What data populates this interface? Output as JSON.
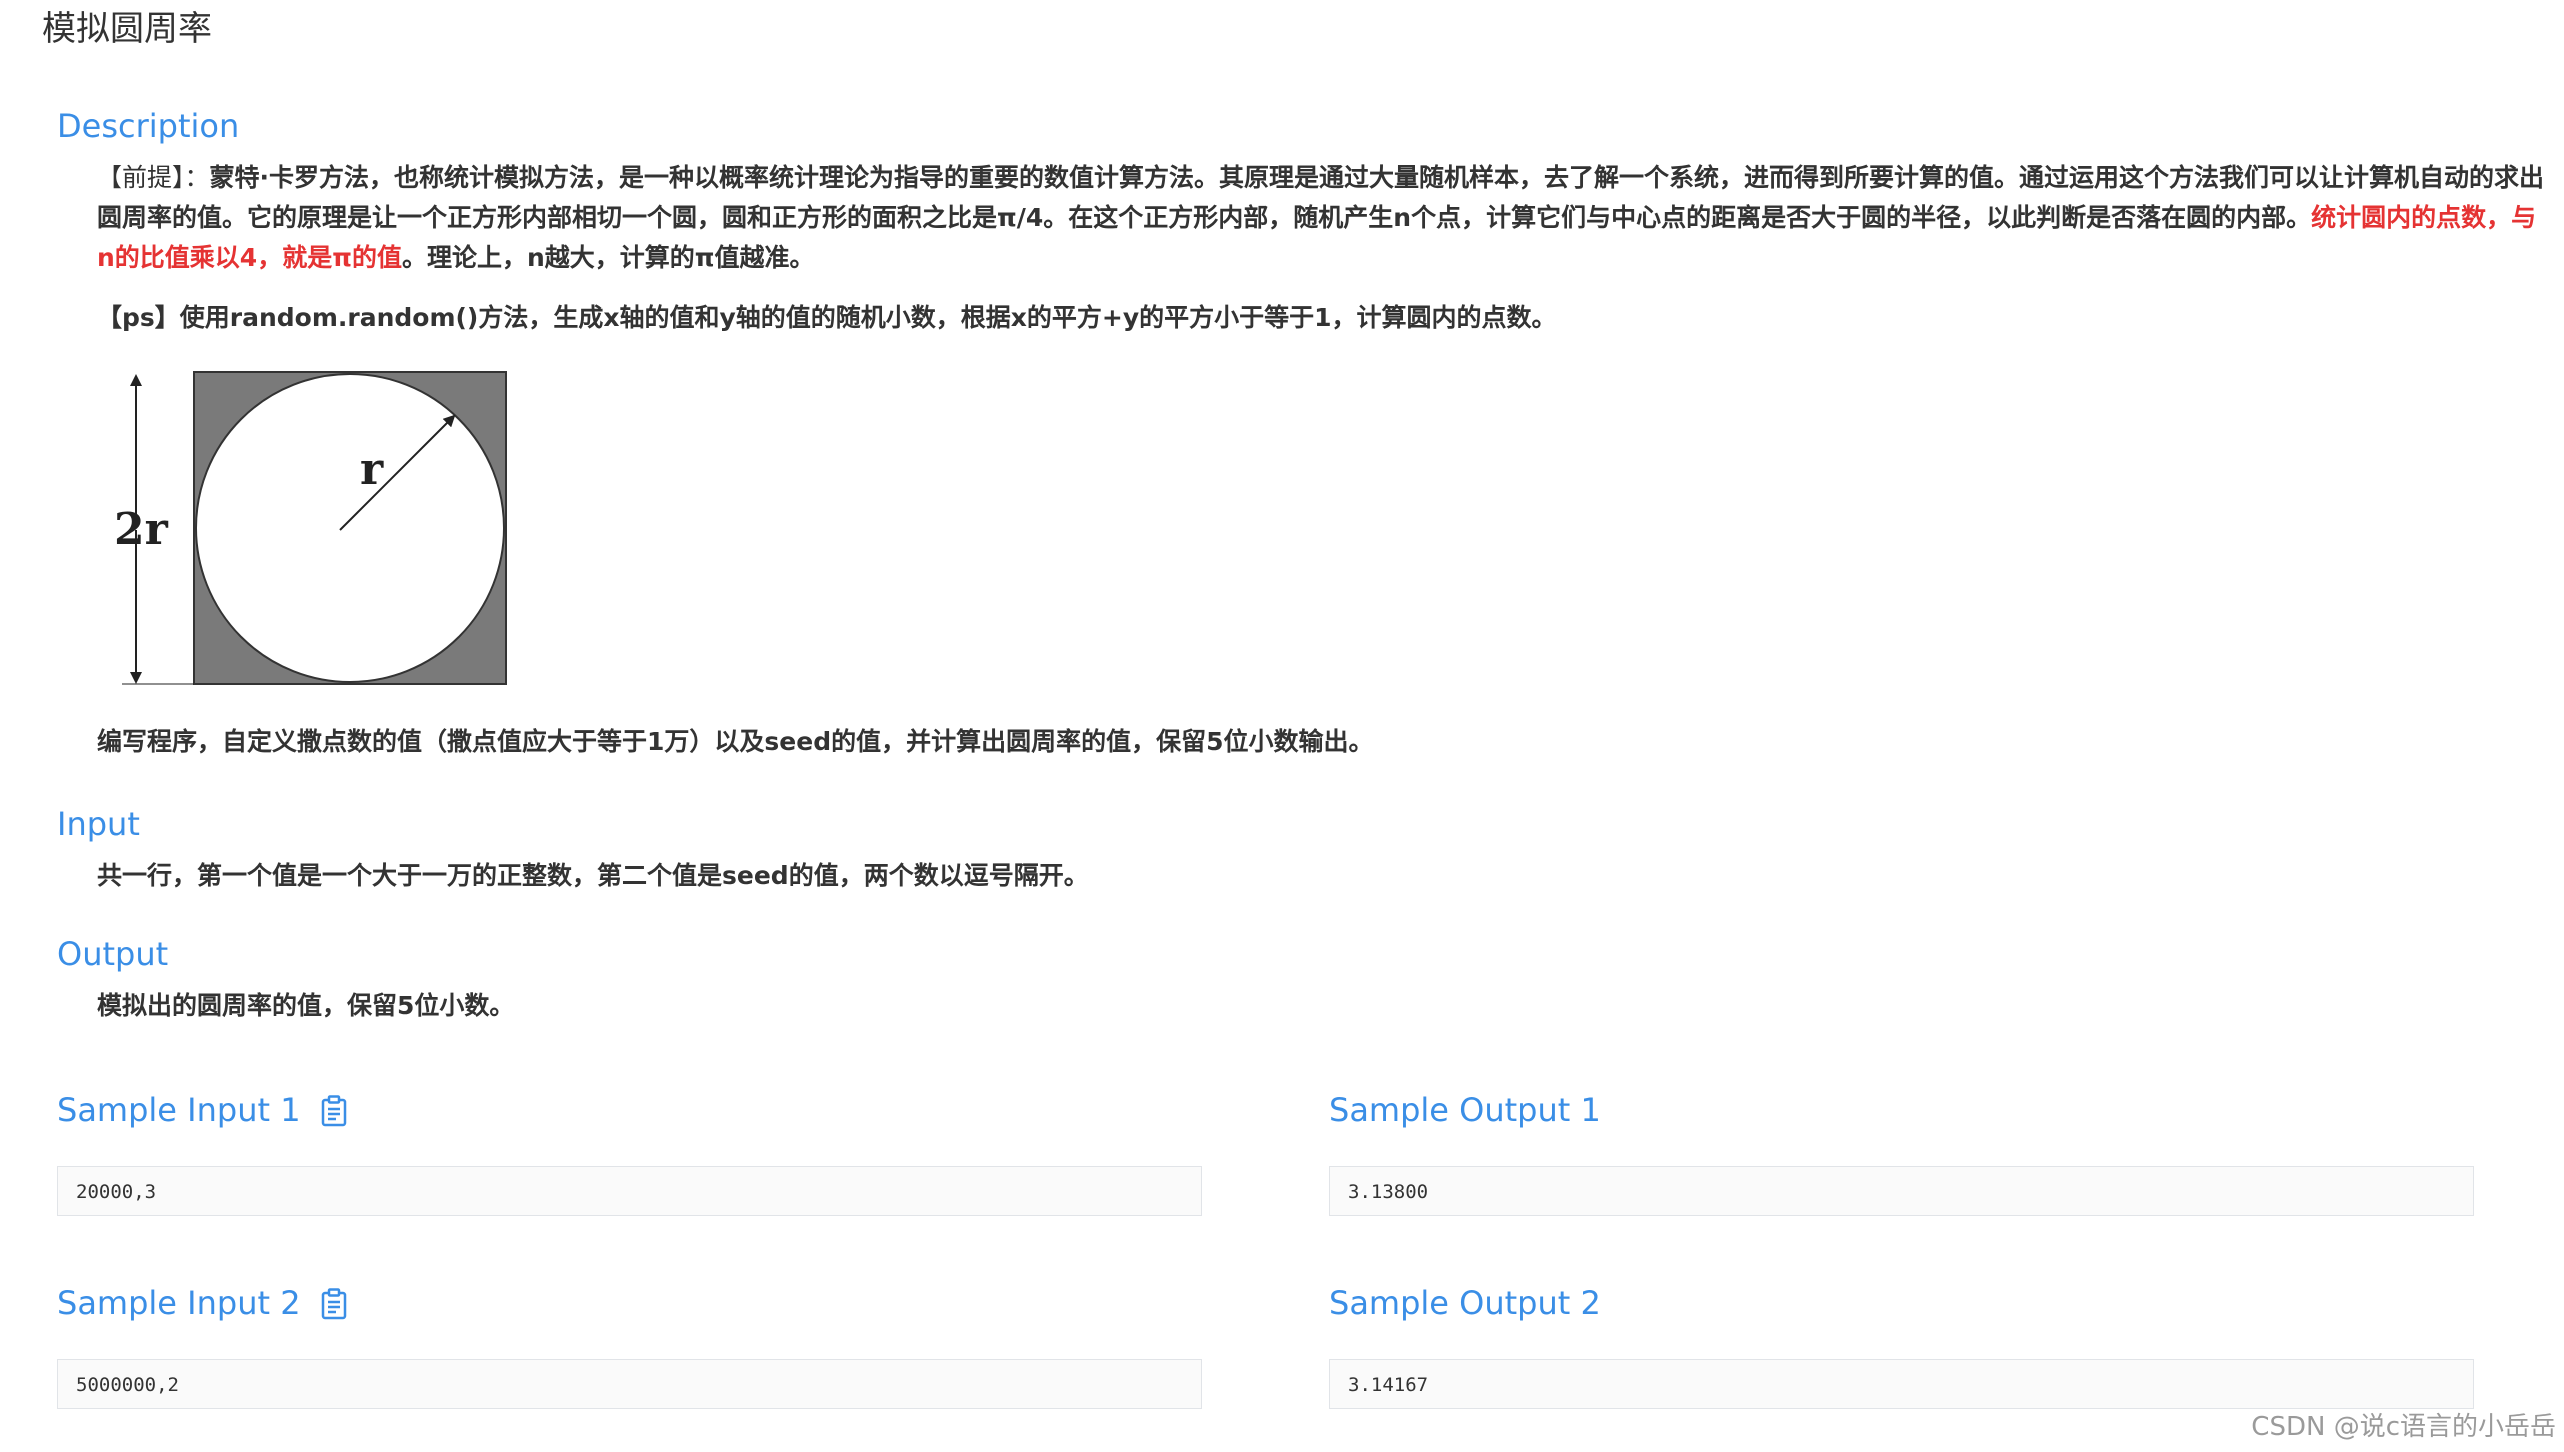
{
  "page": {
    "title": "模拟圆周率"
  },
  "description": {
    "heading": "Description",
    "lead": "【前提】：",
    "text_a": "蒙特·卡罗方法，也称统计模拟方法，是一种以概率统计理论为指导的重要的数值计算方法。其原理是通过大量随机样本，去了解一个系统，进而得到所要计算的值。通过运用这个方法我们可以让计算机自动的求出圆周率的值。它的原理是让一个正方形内部相切一个圆，圆和正方形的面积之比是π/4。在这个正方形内部，随机产生n个点，计算它们与中心点的距离是否大于圆的半径，以此判断是否落在圆的内部。",
    "text_red": "统计圆内的点数，与n的比值乘以4，就是π的值",
    "text_b": "。理论上，n越大，计算的π值越准。",
    "ps": "【ps】使用random.random()方法，生成x轴的值和y轴的值的随机小数，根据x的平方+y的平方小于等于1，计算圆内的点数。",
    "figure": {
      "radius_label": "r",
      "diameter_label": "2r"
    },
    "task": "编写程序，自定义撒点数的值（撒点值应大于等于1万）以及seed的值，并计算出圆周率的值，保留5位小数输出。"
  },
  "input": {
    "heading": "Input",
    "text": "共一行，第一个值是一个大于一万的正整数，第二个值是seed的值，两个数以逗号隔开。"
  },
  "output": {
    "heading": "Output",
    "text": "模拟出的圆周率的值，保留5位小数。"
  },
  "samples": [
    {
      "input_label": "Sample Input 1",
      "input_value": "20000,3",
      "output_label": "Sample Output 1",
      "output_value": "3.13800"
    },
    {
      "input_label": "Sample Input 2",
      "input_value": "5000000,2",
      "output_label": "Sample Output 2",
      "output_value": "3.14167"
    }
  ],
  "icons": {
    "copy": "clipboard-icon"
  },
  "colors": {
    "heading": "#3a8ee6",
    "highlight": "#e53333",
    "text": "#333333"
  },
  "watermark": "CSDN @说c语言的小岳岳"
}
